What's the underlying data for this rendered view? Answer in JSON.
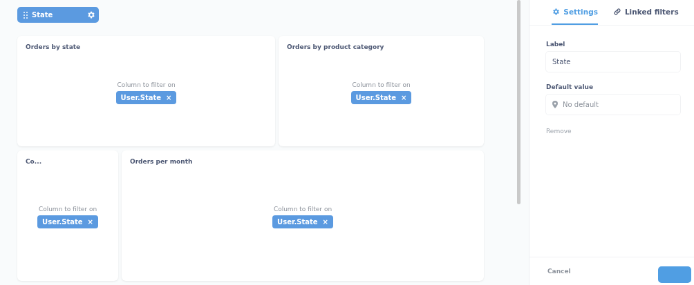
{
  "filter_widget": {
    "label": "State"
  },
  "cards": [
    {
      "title": "Orders by state",
      "prompt": "Column to filter on",
      "chip": "User.State",
      "remove": "×"
    },
    {
      "title": "Orders by product category",
      "prompt": "Column to filter on",
      "chip": "User.State",
      "remove": "×"
    },
    {
      "title": "Co...",
      "prompt": "Column to filter on",
      "chip": "User.State",
      "remove": "×"
    },
    {
      "title": "Orders per month",
      "prompt": "Column to filter on",
      "chip": "User.State",
      "remove": "×"
    }
  ],
  "sidebar": {
    "tabs": [
      {
        "label": "Settings",
        "selected": true
      },
      {
        "label": "Linked filters",
        "selected": false
      }
    ],
    "label_field": {
      "label": "Label",
      "value": "State"
    },
    "default_field": {
      "label": "Default value",
      "placeholder": "No default"
    },
    "remove": "Remove",
    "cancel": "Cancel"
  }
}
